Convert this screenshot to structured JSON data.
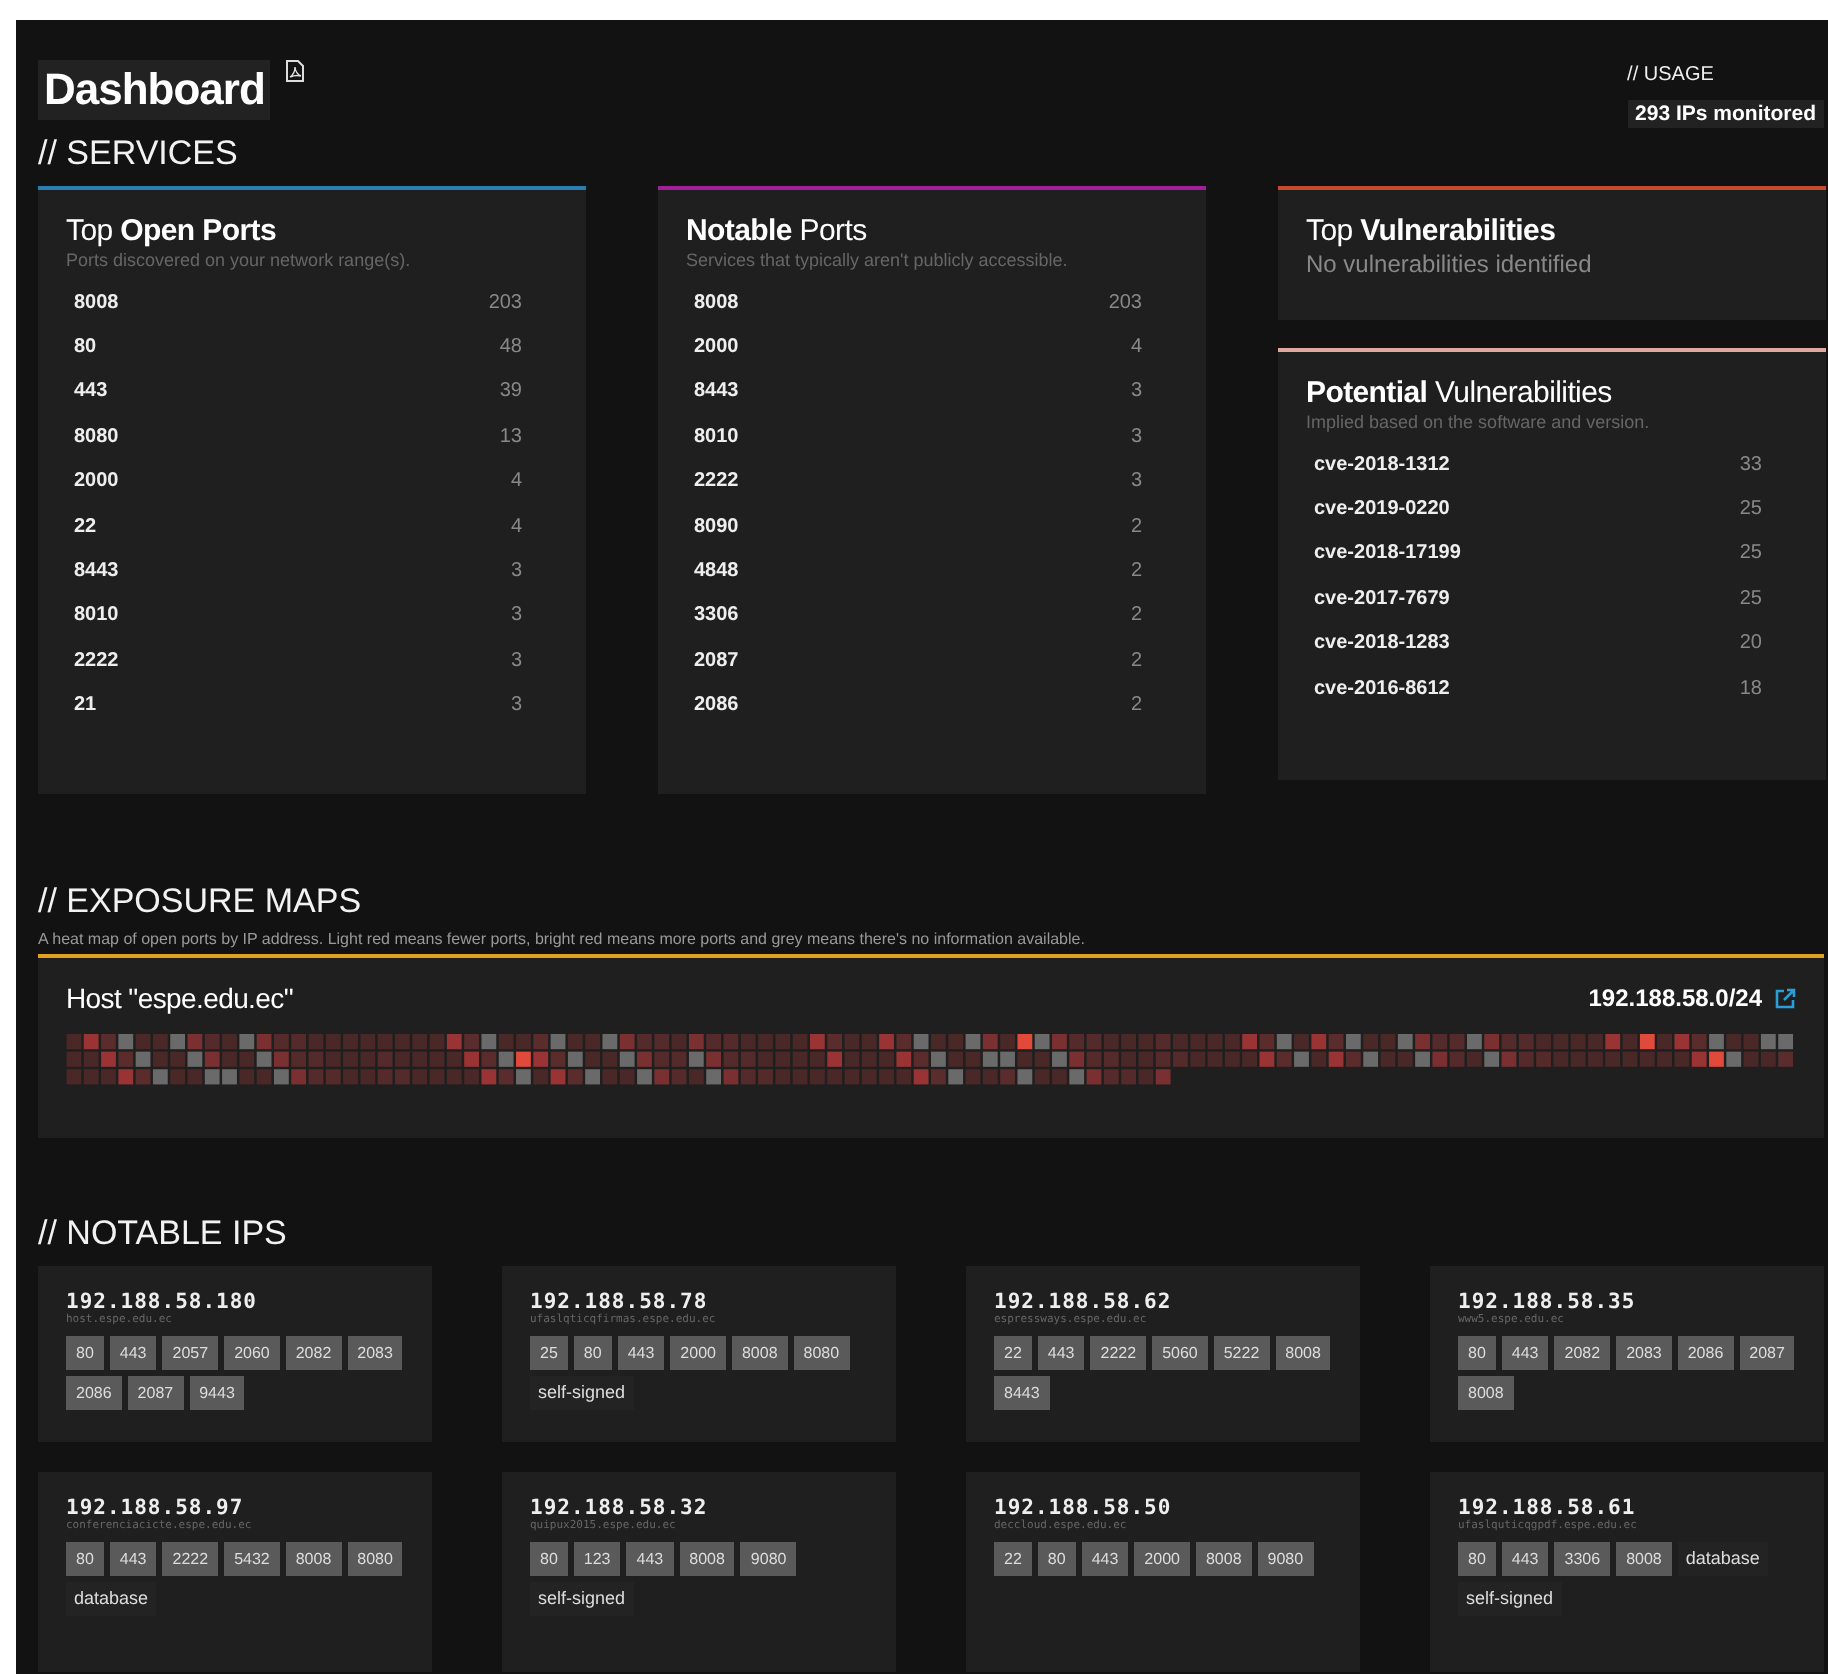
{
  "header": {
    "title": "Dashboard",
    "usage_label": "// USAGE",
    "usage_value": "293 IPs monitored"
  },
  "services": {
    "title": "// SERVICES",
    "cards": [
      {
        "kind": "list",
        "color": "#2a7fb0",
        "heading": "Top **Open Ports**",
        "subtitle": "Ports discovered on your network range(s).",
        "rows": [
          {
            "name": "8008",
            "count": "203"
          },
          {
            "name": "80",
            "count": "48"
          },
          {
            "name": "443",
            "count": "39"
          },
          {
            "name": "8080",
            "count": "13"
          },
          {
            "name": "2000",
            "count": "4"
          },
          {
            "name": "22",
            "count": "4"
          },
          {
            "name": "8443",
            "count": "3"
          },
          {
            "name": "8010",
            "count": "3"
          },
          {
            "name": "2222",
            "count": "3"
          },
          {
            "name": "21",
            "count": "3"
          }
        ]
      },
      {
        "kind": "list",
        "color": "#a0209a",
        "heading": "**Notable** Ports",
        "subtitle": "Services that typically aren't publicly accessible.",
        "rows": [
          {
            "name": "8008",
            "count": "203"
          },
          {
            "name": "2000",
            "count": "4"
          },
          {
            "name": "8443",
            "count": "3"
          },
          {
            "name": "8010",
            "count": "3"
          },
          {
            "name": "2222",
            "count": "3"
          },
          {
            "name": "8090",
            "count": "2"
          },
          {
            "name": "4848",
            "count": "2"
          },
          {
            "name": "3306",
            "count": "2"
          },
          {
            "name": "2087",
            "count": "2"
          },
          {
            "name": "2086",
            "count": "2"
          }
        ]
      },
      {
        "kind": "stack",
        "cards": [
          {
            "kind": "note",
            "color": "#c84a2c",
            "heading": "Top **Vulnerabilities**",
            "subtitle": "No vulnerabilities identified"
          },
          {
            "kind": "list",
            "color": "#e0a8a0",
            "heading": "**Potential** Vulnerabilities",
            "subtitle": "Implied based on the software and version.",
            "rows": [
              {
                "name": "cve-2018-1312",
                "count": "33"
              },
              {
                "name": "cve-2019-0220",
                "count": "25"
              },
              {
                "name": "cve-2018-17199",
                "count": "25"
              },
              {
                "name": "cve-2017-7679",
                "count": "25"
              },
              {
                "name": "cve-2018-1283",
                "count": "20"
              },
              {
                "name": "cve-2016-8612",
                "count": "18"
              }
            ]
          }
        ]
      }
    ]
  },
  "exposure": {
    "title": "// EXPOSURE MAPS",
    "description": "A heat map of open ports by IP address. Light red means fewer ports, bright red means more ports and grey means there's no information available.",
    "host": "Host \"espe.edu.ec\"",
    "range": "192.188.58.0/24"
  },
  "notable_ips": {
    "title": "// NOTABLE IPS",
    "items": [
      {
        "ip": "192.188.58.180",
        "hostname": "host.espe.edu.ec",
        "ports": [
          "80",
          "443",
          "2057",
          "2060",
          "2082",
          "2083",
          "2086",
          "2087",
          "9443"
        ]
      },
      {
        "ip": "192.188.58.78",
        "hostname": "ufaslqticqfirmas.espe.edu.ec",
        "ports": [
          "25",
          "80",
          "443",
          "2000",
          "8008",
          "8080"
        ],
        "tags": [
          "self-signed"
        ]
      },
      {
        "ip": "192.188.58.62",
        "hostname": "espressways.espe.edu.ec",
        "ports": [
          "22",
          "443",
          "2222",
          "5060",
          "5222",
          "8008",
          "8443"
        ]
      },
      {
        "ip": "192.188.58.35",
        "hostname": "www5.espe.edu.ec",
        "ports": [
          "80",
          "443",
          "2082",
          "2083",
          "2086",
          "2087",
          "8008"
        ]
      },
      {
        "ip": "192.188.58.97",
        "hostname": "conferenciacicte.espe.edu.ec",
        "ports": [
          "80",
          "443",
          "2222",
          "5432",
          "8008",
          "8080"
        ],
        "tags": [
          "database"
        ]
      },
      {
        "ip": "192.188.58.32",
        "hostname": "quipux2015.espe.edu.ec",
        "ports": [
          "80",
          "123",
          "443",
          "8008",
          "9080"
        ],
        "tags": [
          "self-signed"
        ]
      },
      {
        "ip": "192.188.58.50",
        "hostname": "deccloud.espe.edu.ec",
        "ports": [
          "22",
          "80",
          "443",
          "2000",
          "8008",
          "9080"
        ]
      },
      {
        "ip": "192.188.58.61",
        "hostname": "ufaslquticqgpdf.espe.edu.ec",
        "ports": [
          "80",
          "443",
          "3306",
          "8008"
        ],
        "tags": [
          "database",
          "self-signed"
        ]
      }
    ]
  }
}
